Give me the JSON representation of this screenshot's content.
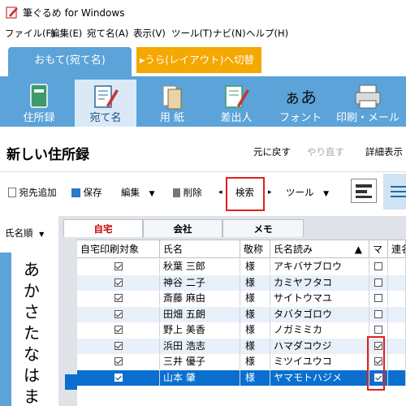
{
  "window": {
    "title": "筆ぐるめ for Windows"
  },
  "menu": [
    "ファイル(F)",
    "編集(E)",
    "宛て名(A)",
    "表示(V)",
    "ツール(T)",
    "ナビ(N)",
    "ヘルプ(H)"
  ],
  "mode_tabs": {
    "active": "おもて(宛て名)",
    "switch": "▸うら(レイアウト)へ切替"
  },
  "ribbon": [
    {
      "label": "住所録",
      "icon": "address-book-icon"
    },
    {
      "label": "宛て名",
      "icon": "recipient-icon",
      "selected": true
    },
    {
      "label": "用 紙",
      "icon": "paper-icon"
    },
    {
      "label": "差出人",
      "icon": "sender-icon"
    },
    {
      "label": "フォント",
      "icon": "font-icon",
      "glyph": "ぁあ"
    },
    {
      "label": "印刷・メール",
      "icon": "printer-icon"
    }
  ],
  "header": {
    "title": "新しい住所録",
    "undo": "元に戻す",
    "redo": "やり直す",
    "detail": "詳細表示"
  },
  "toolbar": {
    "add": "宛先追加",
    "save": "保存",
    "edit": "編集",
    "delete": "削除",
    "search": "検索",
    "tools": "ツール"
  },
  "sidebar": {
    "sort": "氏名順",
    "kana": [
      "あ",
      "か",
      "さ",
      "た",
      "な",
      "は",
      "ま"
    ]
  },
  "grid_tabs": [
    "自宅",
    "会社",
    "メモ"
  ],
  "columns": [
    "自宅印刷対象",
    "氏名",
    "敬称",
    "氏名読み",
    "マ",
    "連名"
  ],
  "rows": [
    {
      "print": true,
      "name": "秋葉 三郎",
      "honorific": "様",
      "reading": "アキバサブロウ",
      "mark": false
    },
    {
      "print": true,
      "name": "神谷 二子",
      "honorific": "様",
      "reading": "カミヤフタコ",
      "mark": false
    },
    {
      "print": true,
      "name": "斎藤 麻由",
      "honorific": "様",
      "reading": "サイトウマユ",
      "mark": false
    },
    {
      "print": true,
      "name": "田畑 五朗",
      "honorific": "様",
      "reading": "タバタゴロウ",
      "mark": false
    },
    {
      "print": true,
      "name": "野上 美香",
      "honorific": "様",
      "reading": "ノガミミカ",
      "mark": false
    },
    {
      "print": true,
      "name": "浜田 浩志",
      "honorific": "様",
      "reading": "ハマダコウジ",
      "mark": true
    },
    {
      "print": true,
      "name": "三井 優子",
      "honorific": "様",
      "reading": "ミツイユウコ",
      "mark": true
    },
    {
      "print": true,
      "name": "山本 肇",
      "honorific": "様",
      "reading": "ヤマモトハジメ",
      "mark": true,
      "selected": true
    }
  ]
}
